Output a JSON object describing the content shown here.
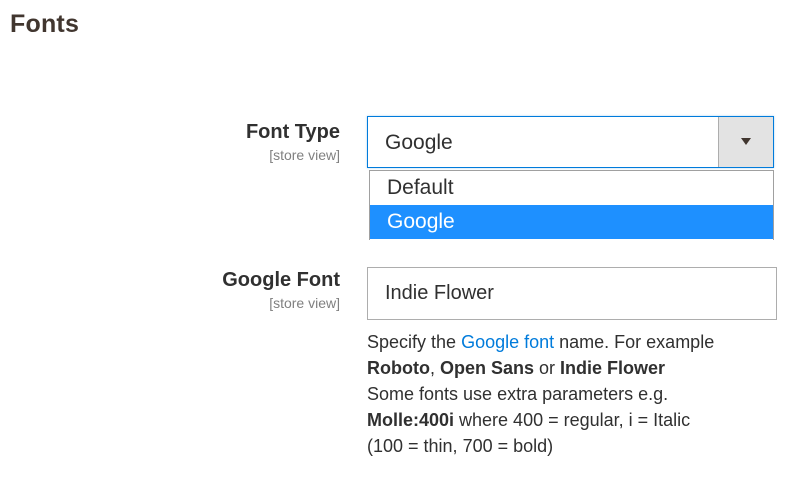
{
  "section": {
    "title": "Fonts"
  },
  "font_type_field": {
    "label": "Font Type",
    "scope": "[store view]",
    "selected_value": "Google",
    "options": [
      "Default",
      "Google"
    ],
    "selected_index": 1
  },
  "google_font_field": {
    "label": "Google Font",
    "scope": "[store view]",
    "value": "Indie Flower"
  },
  "note": {
    "specify_prefix": "Specify the ",
    "link_text": "Google font",
    "specify_suffix": " name. For example",
    "example_1": "Roboto",
    "comma": ", ",
    "example_2": "Open Sans",
    "or": " or ",
    "example_3": "Indie Flower",
    "line_3": "Some fonts use extra parameters e.g.",
    "param_example": "Molle:400i",
    "param_suffix": " where 400 = regular, i = Italic",
    "line_5": "(100 = thin, 700 = bold)"
  },
  "colors": {
    "accent": "#007bdb",
    "selected_option_bg": "#1e90ff",
    "title": "#41362f",
    "text": "#303030",
    "muted": "#808080"
  }
}
